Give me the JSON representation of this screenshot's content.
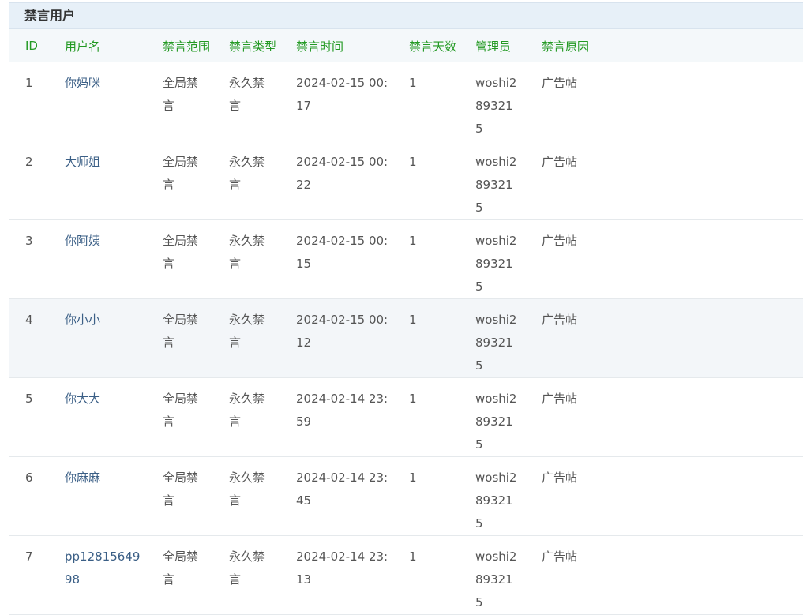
{
  "title": "禁言用户",
  "columns": {
    "id": "ID",
    "user": "用户名",
    "scope": "禁言范围",
    "type": "禁言类型",
    "time": "禁言时间",
    "days": "禁言天数",
    "admin": "管理员",
    "reason": "禁言原因"
  },
  "rows": [
    {
      "id": "1",
      "user": "你妈咪",
      "scope": "全局禁言",
      "type": "永久禁言",
      "time": "2024-02-15 00:17",
      "days": "1",
      "admin": "woshi2893215",
      "reason": "广告帖"
    },
    {
      "id": "2",
      "user": "大师姐",
      "scope": "全局禁言",
      "type": "永久禁言",
      "time": "2024-02-15 00:22",
      "days": "1",
      "admin": "woshi2893215",
      "reason": "广告帖"
    },
    {
      "id": "3",
      "user": "你阿姨",
      "scope": "全局禁言",
      "type": "永久禁言",
      "time": "2024-02-15 00:15",
      "days": "1",
      "admin": "woshi2893215",
      "reason": "广告帖"
    },
    {
      "id": "4",
      "user": "你小小",
      "scope": "全局禁言",
      "type": "永久禁言",
      "time": "2024-02-15 00:12",
      "days": "1",
      "admin": "woshi2893215",
      "reason": "广告帖"
    },
    {
      "id": "5",
      "user": "你大大",
      "scope": "全局禁言",
      "type": "永久禁言",
      "time": "2024-02-14 23:59",
      "days": "1",
      "admin": "woshi2893215",
      "reason": "广告帖"
    },
    {
      "id": "6",
      "user": "你麻麻",
      "scope": "全局禁言",
      "type": "永久禁言",
      "time": "2024-02-14 23:45",
      "days": "1",
      "admin": "woshi2893215",
      "reason": "广告帖"
    },
    {
      "id": "7",
      "user": "pp1281564998",
      "scope": "全局禁言",
      "type": "永久禁言",
      "time": "2024-02-14 23:13",
      "days": "1",
      "admin": "woshi2893215",
      "reason": "广告帖"
    }
  ]
}
